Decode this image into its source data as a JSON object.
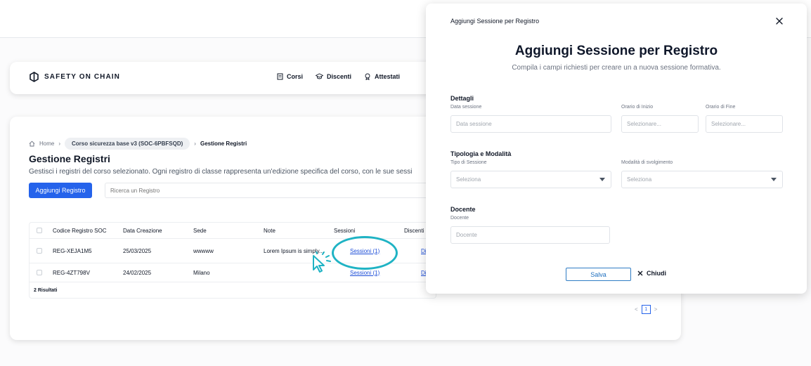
{
  "app": {
    "logo_text": "SAFETY ON CHAIN"
  },
  "nav": {
    "items": [
      {
        "label": "Corsi",
        "icon": "document-icon"
      },
      {
        "label": "Discenti",
        "icon": "graduation-cap-icon"
      },
      {
        "label": "Attestati",
        "icon": "certificate-icon"
      }
    ]
  },
  "breadcrumb": {
    "home": "Home",
    "course": "Corso sicurezza base v3 (SOC-6PBFSQD)",
    "current": "Gestione Registri"
  },
  "page": {
    "title": "Gestione Registri",
    "description": "Gestisci i registri del corso selezionato. Ogni registro di classe rappresenta un'edizione specifica del corso, con le sue sessi",
    "add_button": "Aggiungi Registro",
    "search_placeholder": "Ricerca un Registro"
  },
  "table": {
    "headers": [
      "Codice Registro SOC",
      "Data Creazione",
      "Sede",
      "Note",
      "Sessioni",
      "Discenti"
    ],
    "rows": [
      {
        "code": "REG-XEJA1M5",
        "date": "25/03/2025",
        "sede": "wwwww",
        "note": "Lorem Ipsum is simply...",
        "sessions": "Sessioni (1)",
        "discenti": "Di"
      },
      {
        "code": "REG-4ZT798V",
        "date": "24/02/2025",
        "sede": "Milano",
        "note": "",
        "sessions": "Sessioni (1)",
        "discenti": "Di"
      }
    ],
    "results": "2 Risultati"
  },
  "pager": {
    "prev": "<",
    "page": "1",
    "next": ">"
  },
  "modal": {
    "header": "Aggiungi Sessione per Registro",
    "title": "Aggiungi Sessione per Registro",
    "subtitle": "Compila i campi richiesti per creare un a nuova sessione formativa.",
    "dettagli": {
      "title": "Dettagli",
      "date_label": "Data sessione",
      "date_placeholder": "Data sessione",
      "start_label": "Orario di Inizio",
      "start_placeholder": "Selezionare...",
      "end_label": "Orario di Fine",
      "end_placeholder": "Selezionare..."
    },
    "tipologia": {
      "title": "Tipologia e Modalità",
      "type_label": "Tipo di Sessione",
      "type_value": "Seleziona",
      "mode_label": "Modalità di svolgimento",
      "mode_value": "Seleziona"
    },
    "docente": {
      "title": "Docente",
      "label": "Docente",
      "placeholder": "Docente"
    },
    "save_label": "Salva",
    "close_label": "Chiudi"
  },
  "colors": {
    "primary": "#2563eb",
    "accent_ring": "#1fb3c4"
  }
}
